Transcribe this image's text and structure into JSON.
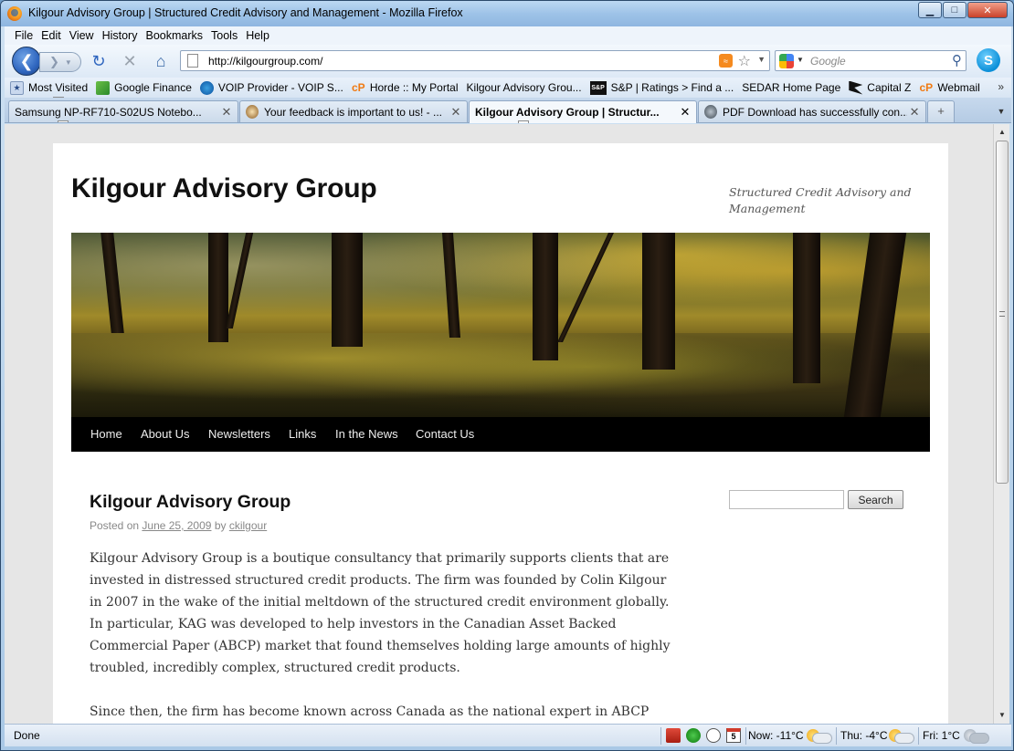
{
  "window": {
    "title": "Kilgour Advisory Group | Structured Credit Advisory and Management - Mozilla Firefox"
  },
  "menu": [
    "File",
    "Edit",
    "View",
    "History",
    "Bookmarks",
    "Tools",
    "Help"
  ],
  "nav": {
    "url": "http://kilgourgroup.com/",
    "search_placeholder": "Google"
  },
  "bookmarks": [
    {
      "label": "Most Visited",
      "icon": "most-visited-icon"
    },
    {
      "label": "Google Finance",
      "icon": "google-finance-icon"
    },
    {
      "label": "VOIP Provider - VOIP S...",
      "icon": "globe-icon"
    },
    {
      "label": "Horde :: My Portal",
      "icon": "cpanel-icon"
    },
    {
      "label": "Kilgour Advisory Grou...",
      "icon": "page-icon"
    },
    {
      "label": "S&P | Ratings > Find a ...",
      "icon": "sp-icon"
    },
    {
      "label": "SEDAR Home Page",
      "icon": "page-icon"
    },
    {
      "label": "Capital Z",
      "icon": "capital-z-icon"
    },
    {
      "label": "Webmail",
      "icon": "cpanel-icon"
    }
  ],
  "tabs": [
    {
      "label": "Samsung NP-RF710-S02US Notebo...",
      "active": false
    },
    {
      "label": "Your feedback is important to us! - ...",
      "active": false
    },
    {
      "label": "Kilgour Advisory Group | Structur...",
      "active": true
    },
    {
      "label": "PDF Download has successfully con...",
      "active": false
    }
  ],
  "site": {
    "title": "Kilgour Advisory Group",
    "tagline": "Structured Credit Advisory and Management",
    "menu": [
      "Home",
      "About Us",
      "Newsletters",
      "Links",
      "In the News",
      "Contact Us"
    ],
    "search_button": "Search"
  },
  "post": {
    "title": "Kilgour Advisory Group",
    "posted_on": "Posted on",
    "date": "June 25, 2009",
    "by": "by",
    "author": "ckilgour",
    "paragraphs": [
      "Kilgour Advisory Group is a boutique consultancy that primarily supports clients that are invested in distressed structured credit products.  The firm was founded by Colin Kilgour in 2007 in the wake of the initial meltdown of the structured credit environment globally. In particular, KAG was developed to help investors in the Canadian Asset Backed Commercial Paper (ABCP) market that found themselves holding large amounts of highly troubled, incredibly complex, structured credit products.",
      "Since then, the firm has become known across Canada as the national expert in ABCP"
    ]
  },
  "status": {
    "text": "Done",
    "weather_now": "Now: -11°C",
    "weather_thu": "Thu: -4°C",
    "weather_fri": "Fri: 1°C"
  }
}
